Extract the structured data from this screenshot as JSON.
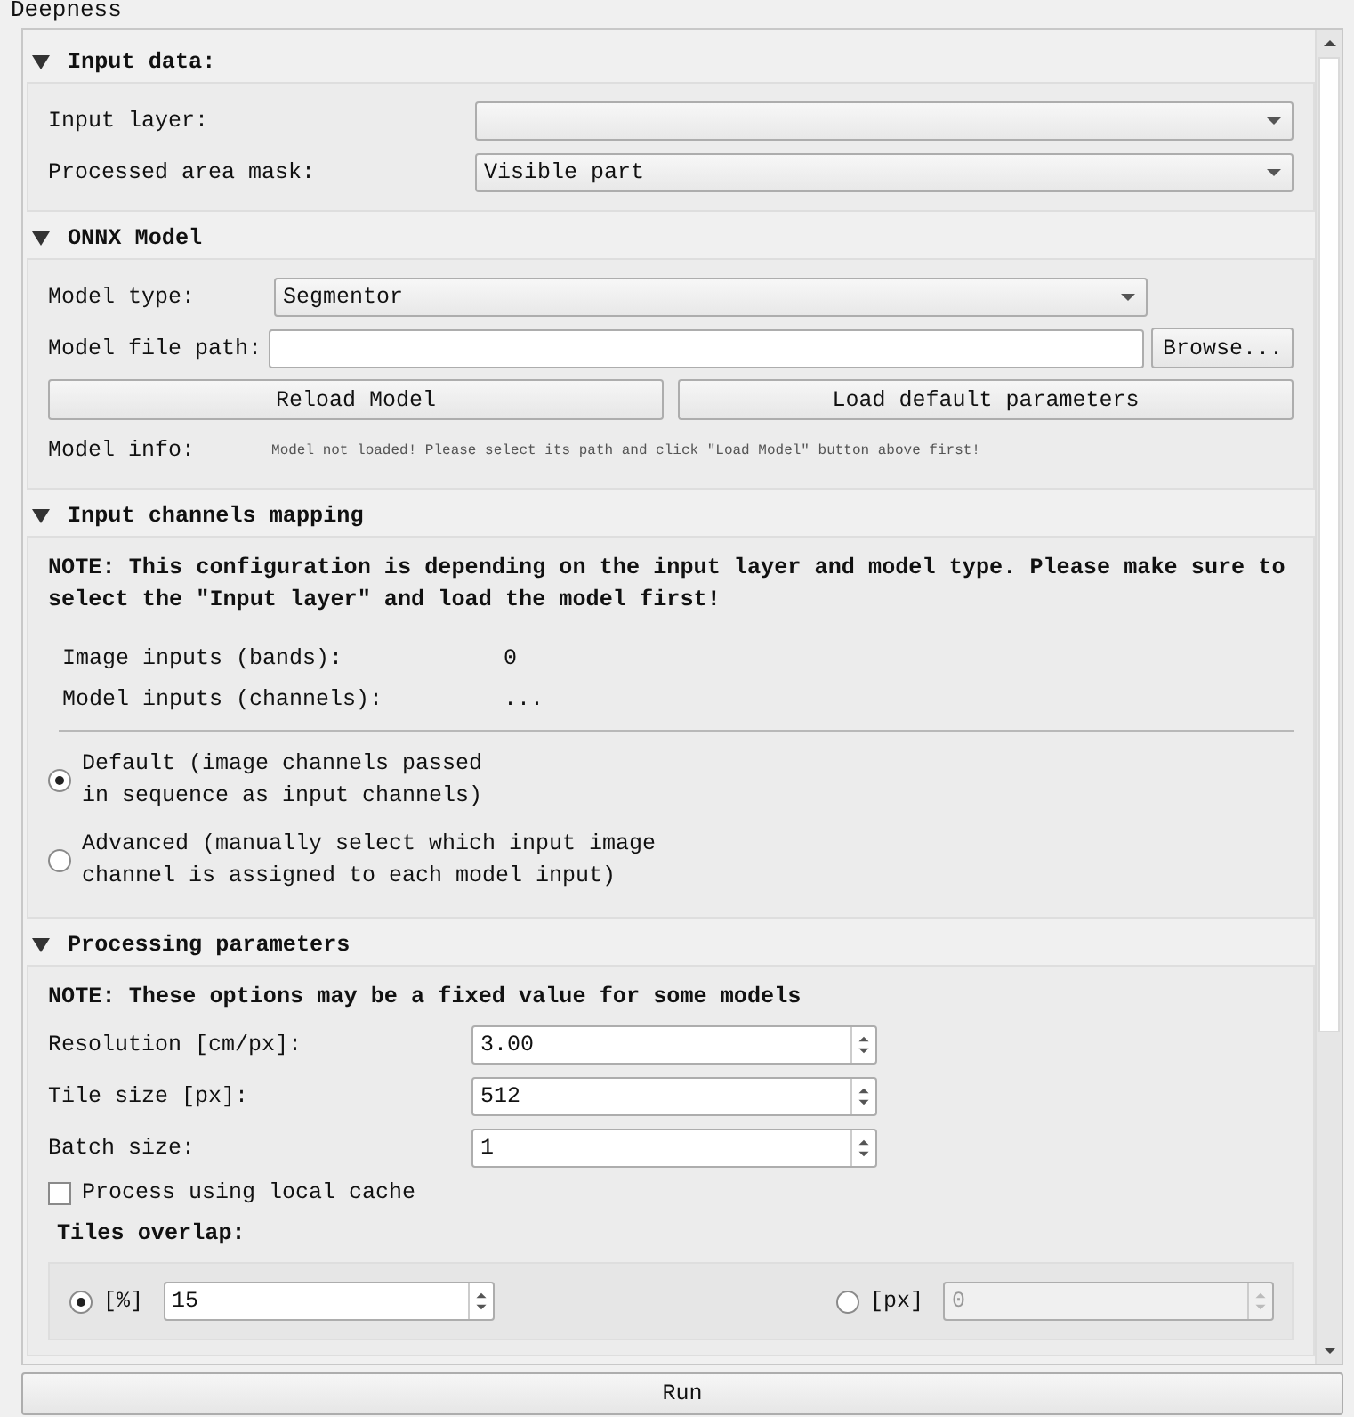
{
  "window": {
    "title": "Deepness"
  },
  "input_data": {
    "header": "Input data:",
    "expanded": true,
    "fields": [
      {
        "label": "Input layer:"
      },
      {
        "label": "Processed area mask:",
        "value": "Visible part"
      }
    ]
  },
  "onnx_model": {
    "header": "ONNX Model",
    "expanded": true,
    "model_type": {
      "label": "Model type:",
      "value": "Segmentor"
    },
    "model_file_path": {
      "label": "Model file path:",
      "browse_button": "Browse..."
    },
    "buttons": [
      "Reload Model",
      "Load default parameters"
    ],
    "model_info": {
      "label": "Model info:",
      "text": "Model not loaded! Please select its path and click \"Load Model\" button above first!"
    }
  },
  "channels_mapping": {
    "header": "Input channels mapping",
    "expanded": true,
    "note": "NOTE: This configuration is depending on the input layer and model type. Please make sure to select the \"Input layer\" and load the model first!",
    "stats": [
      {
        "label": "Image inputs (bands):",
        "value": "0"
      },
      {
        "label": "Model inputs (channels):",
        "value": "..."
      }
    ],
    "options": [
      {
        "label": "Default (image channels passed\nin sequence as input channels)",
        "selected": true
      },
      {
        "label": "Advanced (manually select which input image\nchannel is assigned to each model input)",
        "selected": false
      }
    ]
  },
  "processing": {
    "header": "Processing parameters",
    "expanded": true,
    "note": "NOTE: These options may be a fixed value for some models",
    "spins": [
      {
        "label": "Resolution [cm/px]:",
        "value": "3.00"
      },
      {
        "label": "Tile size [px]:",
        "value": "512"
      },
      {
        "label": "Batch size:",
        "value": "1"
      }
    ],
    "cache_checkbox": {
      "label": "Process using local cache",
      "checked": false
    },
    "tiles_overlap": {
      "title": "Tiles overlap:",
      "options": [
        {
          "unit": "[%]",
          "value": "15",
          "selected": true
        },
        {
          "unit": "[px]",
          "value": "0",
          "selected": false
        }
      ]
    }
  },
  "run_button": "Run"
}
